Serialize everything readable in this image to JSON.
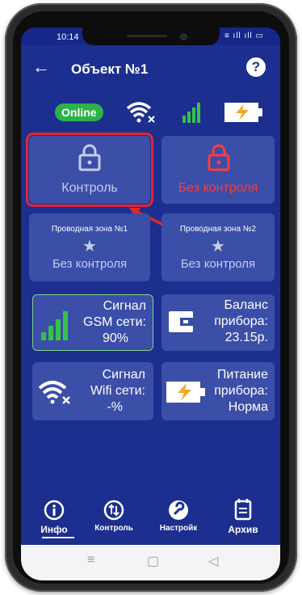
{
  "statusbar": {
    "time": "10:14",
    "right": "≡ ıll ıll ▭"
  },
  "appbar": {
    "back": "←",
    "title": "Объект №1",
    "help": "?"
  },
  "status_icons": {
    "online": "Online",
    "wifi_icon": "wifi-off-icon",
    "signal_icon": "signal-icon",
    "battery_icon": "battery-charging-icon"
  },
  "tiles": {
    "control": {
      "label": "Контроль",
      "icon": "lock-icon",
      "color": "#c6cde8"
    },
    "no_control": {
      "label": "Без контроля",
      "icon": "lock-icon",
      "color": "#ff3b3b"
    },
    "zone1": {
      "title": "Проводная зона №1",
      "status": "Без контроля"
    },
    "zone2": {
      "title": "Проводная зона №2",
      "status": "Без контроля"
    },
    "gsm": {
      "line1": "Сигнал",
      "line2": "GSM сети:",
      "value": "90%"
    },
    "balance": {
      "line1": "Баланс",
      "line2": "прибора:",
      "value": "23.15р."
    },
    "wifi": {
      "line1": "Сигнал",
      "line2": "Wifi сети:",
      "value": "-%"
    },
    "power": {
      "line1": "Питание",
      "line2": "прибора:",
      "value": "Норма"
    }
  },
  "bottom_nav": [
    {
      "label": "Инфо",
      "icon": "info-icon",
      "active": true
    },
    {
      "label": "Контроль",
      "icon": "control-icon",
      "active": false
    },
    {
      "label": "Настройк",
      "icon": "wrench-icon",
      "active": false
    },
    {
      "label": "Архив",
      "icon": "archive-icon",
      "active": false
    }
  ],
  "system_nav": {
    "menu": "≡",
    "home": "▢",
    "back": "◁"
  },
  "colors": {
    "background": "#1c2f8f",
    "tile": "#3b4ea8",
    "accent_red": "#e2262e",
    "green": "#2db24a"
  }
}
